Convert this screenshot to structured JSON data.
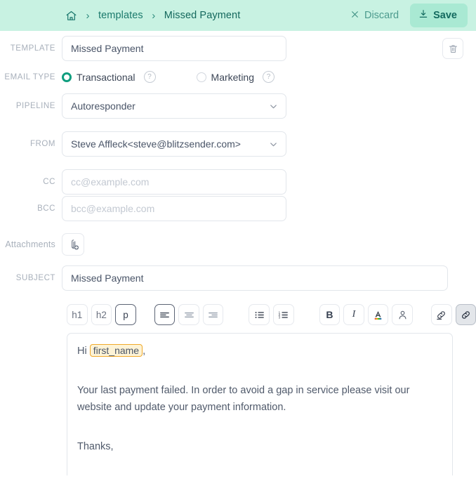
{
  "header": {
    "home_icon": "home-icon",
    "separator": "›",
    "breadcrumb": [
      "templates",
      "Missed Payment"
    ],
    "discard_label": "Discard",
    "discard_icon": "close-x-icon",
    "save_label": "Save",
    "save_icon": "download-save-icon",
    "bg_color": "#c8f2e2",
    "save_bg_color": "#a9e9d3",
    "text_color": "#17756a"
  },
  "form": {
    "template": {
      "label": "TEMPLATE",
      "value": "Missed Payment"
    },
    "delete_icon": "trash-icon",
    "email_type": {
      "label": "EMAIL TYPE",
      "options": [
        {
          "label": "Transactional",
          "selected": true,
          "help": "?"
        },
        {
          "label": "Marketing",
          "selected": false,
          "help": "?"
        }
      ],
      "accent_color": "#109e7f"
    },
    "pipeline": {
      "label": "PIPELINE",
      "value": "Autoresponder",
      "chevron": "chevron-down-icon"
    },
    "from": {
      "label": "FROM",
      "value": "Steve Affleck<steve@blitzsender.com>",
      "chevron": "chevron-down-icon"
    },
    "cc": {
      "label": "CC",
      "value": "",
      "placeholder": "cc@example.com"
    },
    "bcc": {
      "label": "BCC",
      "value": "",
      "placeholder": "bcc@example.com"
    },
    "attachments": {
      "label": "Attachments",
      "icon": "paperclip-add-icon"
    },
    "subject": {
      "label": "SUBJECT",
      "value": "Missed Payment"
    }
  },
  "editor": {
    "toolbar": [
      {
        "name": "heading-1-button",
        "label": "h1",
        "state": "normal"
      },
      {
        "name": "heading-2-button",
        "label": "h2",
        "state": "normal"
      },
      {
        "name": "paragraph-button",
        "label": "p",
        "state": "active"
      },
      {
        "name": "align-left-button",
        "label": "",
        "state": "active"
      },
      {
        "name": "align-center-button",
        "label": "",
        "state": "normal"
      },
      {
        "name": "align-right-button",
        "label": "",
        "state": "normal"
      },
      {
        "name": "bullet-list-button",
        "label": "",
        "state": "normal"
      },
      {
        "name": "numbered-list-button",
        "label": "",
        "state": "normal"
      },
      {
        "name": "bold-button",
        "label": "B",
        "state": "normal"
      },
      {
        "name": "italic-button",
        "label": "I",
        "state": "normal"
      },
      {
        "name": "text-color-button",
        "label": "A",
        "state": "normal"
      },
      {
        "name": "merge-tag-button",
        "label": "",
        "state": "normal"
      },
      {
        "name": "insert-link-button",
        "label": "",
        "state": "normal"
      },
      {
        "name": "unlink-button",
        "label": "",
        "state": "pressed"
      }
    ],
    "content": {
      "greeting_prefix": "Hi ",
      "merge_tag": "first_name",
      "greeting_suffix": ",",
      "paragraph": "Your last payment failed.  In order to avoid a gap in service please visit our website and update your payment information.",
      "signoff": "Thanks,",
      "merge_tag_bg": "#fdf3d6",
      "merge_tag_border": "#f0a92a"
    }
  }
}
